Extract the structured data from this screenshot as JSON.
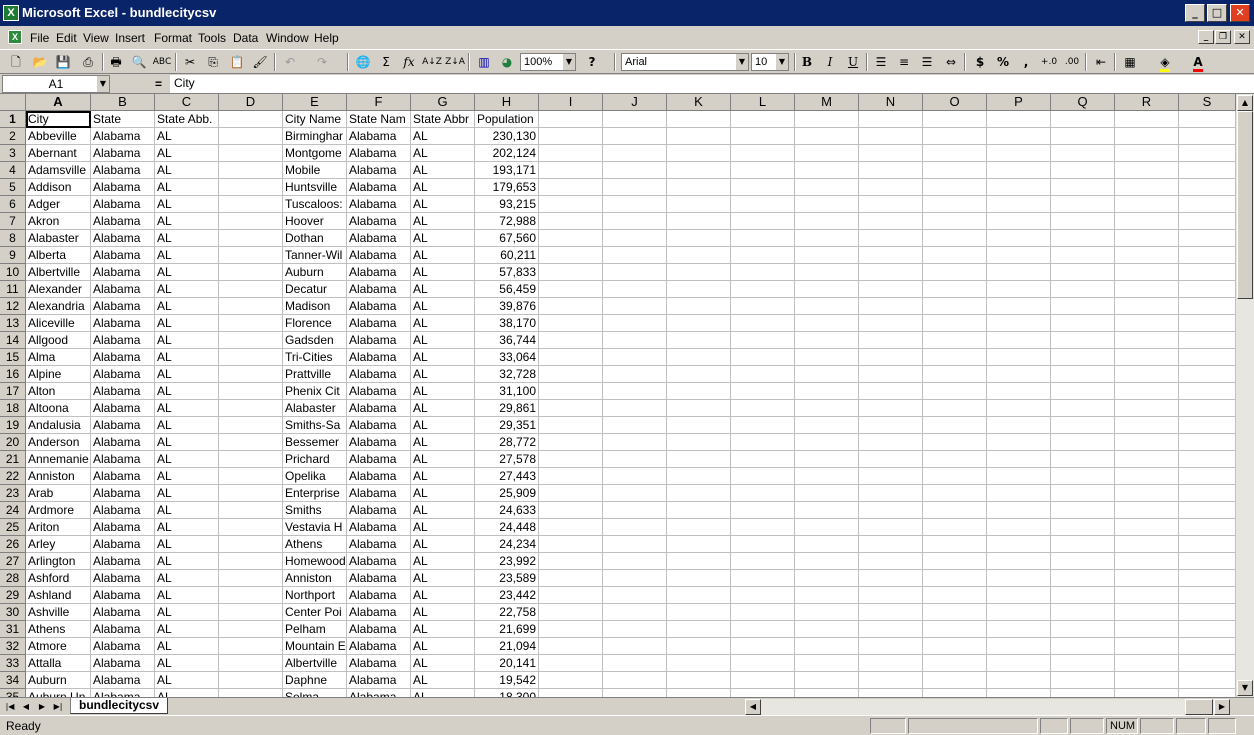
{
  "window": {
    "title": "Microsoft Excel - bundlecitycsv",
    "icon": "excel-icon",
    "controls": [
      "_",
      "□",
      "✕"
    ]
  },
  "menu": {
    "items": [
      "File",
      "Edit",
      "View",
      "Insert",
      "Format",
      "Tools",
      "Data",
      "Window",
      "Help"
    ],
    "doc_controls": [
      "_",
      "❐",
      "✕"
    ]
  },
  "toolbar": {
    "zoom": "100%",
    "font_name": "Arial",
    "font_size": "10",
    "bold": "B",
    "italic": "I",
    "underline": "U",
    "currency": "$",
    "percent": "%",
    "comma": ",",
    "sigma": "Σ",
    "fx": "fx",
    "help": "?",
    "icons": [
      "new-icon",
      "open-icon",
      "save-icon",
      "print-icon",
      "print-preview-icon",
      "spelling-icon",
      "cut-icon",
      "copy-icon",
      "paste-icon",
      "format-painter-icon",
      "undo-icon",
      "redo-icon",
      "hyperlink-icon",
      "autosum-icon",
      "function-icon",
      "sort-ascending-icon",
      "sort-descending-icon",
      "chart-wizard-icon",
      "map-icon",
      "zoom-combo",
      "help-icon",
      "font-combo",
      "font-size-combo",
      "bold-icon",
      "italic-icon",
      "underline-icon",
      "align-left-icon",
      "align-center-icon",
      "align-right-icon",
      "merge-center-icon",
      "currency-icon",
      "percent-icon",
      "comma-icon",
      "increase-decimal-icon",
      "decrease-decimal-icon",
      "decrease-indent-icon",
      "borders-icon",
      "fill-color-icon",
      "font-color-icon"
    ],
    "colors": {
      "fill": "#ffff00",
      "font": "#ff0000"
    }
  },
  "formula_bar": {
    "name_box": "A1",
    "equals": "=",
    "content": "City"
  },
  "grid": {
    "columns": [
      "A",
      "B",
      "C",
      "D",
      "E",
      "F",
      "G",
      "H",
      "I",
      "J",
      "K",
      "L",
      "M",
      "N",
      "O",
      "P",
      "Q",
      "R",
      "S"
    ],
    "selected_column": "A",
    "active_cell": "A1",
    "row_numbers": [
      "1",
      "2",
      "3",
      "4",
      "5",
      "6",
      "7",
      "8",
      "9",
      "10",
      "11",
      "12",
      "13",
      "14",
      "15",
      "16",
      "17",
      "18",
      "19",
      "20",
      "21",
      "22",
      "23",
      "24",
      "25",
      "26",
      "27",
      "28",
      "29",
      "30",
      "31",
      "32",
      "33",
      "34",
      "35"
    ],
    "rows": [
      [
        "City",
        "State",
        "State Abb.",
        "",
        "City Name",
        "State Nam",
        "State Abbr",
        "Population"
      ],
      [
        "Abbeville",
        "Alabama",
        "AL",
        "",
        "Birminghar",
        "Alabama",
        "AL",
        "230,130"
      ],
      [
        "Abernant",
        "Alabama",
        "AL",
        "",
        "Montgome",
        "Alabama",
        "AL",
        "202,124"
      ],
      [
        "Adamsville",
        "Alabama",
        "AL",
        "",
        "Mobile",
        "Alabama",
        "AL",
        "193,171"
      ],
      [
        "Addison",
        "Alabama",
        "AL",
        "",
        "Huntsville",
        "Alabama",
        "AL",
        "179,653"
      ],
      [
        "Adger",
        "Alabama",
        "AL",
        "",
        "Tuscaloos:",
        "Alabama",
        "AL",
        "93,215"
      ],
      [
        "Akron",
        "Alabama",
        "AL",
        "",
        "Hoover",
        "Alabama",
        "AL",
        "72,988"
      ],
      [
        "Alabaster",
        "Alabama",
        "AL",
        "",
        "Dothan",
        "Alabama",
        "AL",
        "67,560"
      ],
      [
        "Alberta",
        "Alabama",
        "AL",
        "",
        "Tanner-Wil",
        "Alabama",
        "AL",
        "60,211"
      ],
      [
        "Albertville",
        "Alabama",
        "AL",
        "",
        "Auburn",
        "Alabama",
        "AL",
        "57,833"
      ],
      [
        "Alexander",
        "Alabama",
        "AL",
        "",
        "Decatur",
        "Alabama",
        "AL",
        "56,459"
      ],
      [
        "Alexandria",
        "Alabama",
        "AL",
        "",
        "Madison",
        "Alabama",
        "AL",
        "39,876"
      ],
      [
        "Aliceville",
        "Alabama",
        "AL",
        "",
        "Florence",
        "Alabama",
        "AL",
        "38,170"
      ],
      [
        "Allgood",
        "Alabama",
        "AL",
        "",
        "Gadsden",
        "Alabama",
        "AL",
        "36,744"
      ],
      [
        "Alma",
        "Alabama",
        "AL",
        "",
        "Tri-Cities",
        "Alabama",
        "AL",
        "33,064"
      ],
      [
        "Alpine",
        "Alabama",
        "AL",
        "",
        "Prattville",
        "Alabama",
        "AL",
        "32,728"
      ],
      [
        "Alton",
        "Alabama",
        "AL",
        "",
        "Phenix Cit",
        "Alabama",
        "AL",
        "31,100"
      ],
      [
        "Altoona",
        "Alabama",
        "AL",
        "",
        "Alabaster",
        "Alabama",
        "AL",
        "29,861"
      ],
      [
        "Andalusia",
        "Alabama",
        "AL",
        "",
        "Smiths-Sa",
        "Alabama",
        "AL",
        "29,351"
      ],
      [
        "Anderson",
        "Alabama",
        "AL",
        "",
        "Bessemer",
        "Alabama",
        "AL",
        "28,772"
      ],
      [
        "Annemanie",
        "Alabama",
        "AL",
        "",
        "Prichard",
        "Alabama",
        "AL",
        "27,578"
      ],
      [
        "Anniston",
        "Alabama",
        "AL",
        "",
        "Opelika",
        "Alabama",
        "AL",
        "27,443"
      ],
      [
        "Arab",
        "Alabama",
        "AL",
        "",
        "Enterprise",
        "Alabama",
        "AL",
        "25,909"
      ],
      [
        "Ardmore",
        "Alabama",
        "AL",
        "",
        "Smiths",
        "Alabama",
        "AL",
        "24,633"
      ],
      [
        "Ariton",
        "Alabama",
        "AL",
        "",
        "Vestavia H",
        "Alabama",
        "AL",
        "24,448"
      ],
      [
        "Arley",
        "Alabama",
        "AL",
        "",
        "Athens",
        "Alabama",
        "AL",
        "24,234"
      ],
      [
        "Arlington",
        "Alabama",
        "AL",
        "",
        "Homewood",
        "Alabama",
        "AL",
        "23,992"
      ],
      [
        "Ashford",
        "Alabama",
        "AL",
        "",
        "Anniston",
        "Alabama",
        "AL",
        "23,589"
      ],
      [
        "Ashland",
        "Alabama",
        "AL",
        "",
        "Northport",
        "Alabama",
        "AL",
        "23,442"
      ],
      [
        "Ashville",
        "Alabama",
        "AL",
        "",
        "Center Poi",
        "Alabama",
        "AL",
        "22,758"
      ],
      [
        "Athens",
        "Alabama",
        "AL",
        "",
        "Pelham",
        "Alabama",
        "AL",
        "21,699"
      ],
      [
        "Atmore",
        "Alabama",
        "AL",
        "",
        "Mountain E",
        "Alabama",
        "AL",
        "21,094"
      ],
      [
        "Attalla",
        "Alabama",
        "AL",
        "",
        "Albertville",
        "Alabama",
        "AL",
        "20,141"
      ],
      [
        "Auburn",
        "Alabama",
        "AL",
        "",
        "Daphne",
        "Alabama",
        "AL",
        "19,542"
      ],
      [
        "Auburn Un",
        "Alabama",
        "AL",
        "",
        "Selma",
        "Alabama",
        "AL",
        "18,300"
      ]
    ]
  },
  "sheets": {
    "active": "bundlecitycsv"
  },
  "status": {
    "ready": "Ready",
    "num": "NUM"
  }
}
